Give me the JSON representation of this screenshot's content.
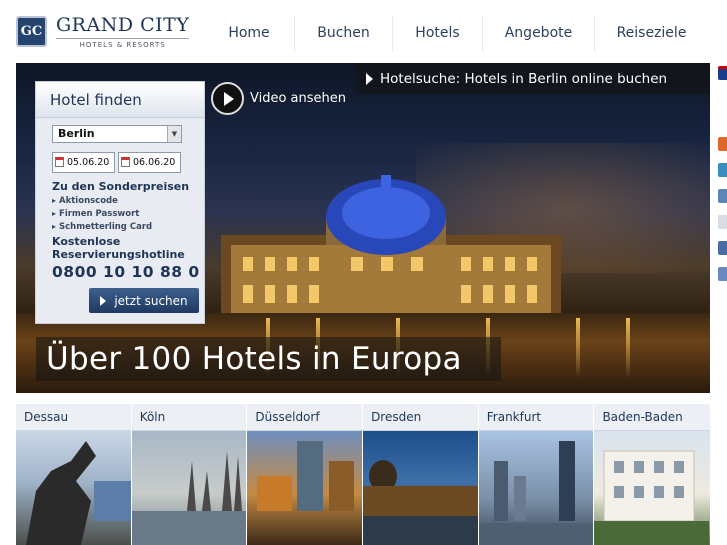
{
  "brand": {
    "name": "GRAND CITY",
    "tagline": "HOTELS & RESORTS",
    "mark": "GC"
  },
  "nav": [
    {
      "label": "Home"
    },
    {
      "label": "Buchen"
    },
    {
      "label": "Hotels"
    },
    {
      "label": "Angebote"
    },
    {
      "label": "Reiseziele"
    }
  ],
  "hero": {
    "caption": "Hotelsuche: Hotels in Berlin online buchen",
    "video_label": "Video ansehen",
    "slogan": "Über 100 Hotels in Europa"
  },
  "search": {
    "title": "Hotel finden",
    "city": "Berlin",
    "arrival": "05.06.20",
    "departure": "06.06.20",
    "special_prices": "Zu den Sonderpreisen",
    "links": [
      "Aktionscode",
      "Firmen Passwort",
      "Schmetterling Card"
    ],
    "hotline_label": "Kostenlose Reservierungshotline",
    "phone": "0800 10 10 88 0",
    "button": "jetzt suchen"
  },
  "cities": [
    {
      "name": "Dessau"
    },
    {
      "name": "Köln"
    },
    {
      "name": "Düsseldorf"
    },
    {
      "name": "Dresden"
    },
    {
      "name": "Frankfurt"
    },
    {
      "name": "Baden-Baden"
    }
  ],
  "colors": {
    "brand_navy": "#1f3557",
    "button": "#2b4a77"
  }
}
